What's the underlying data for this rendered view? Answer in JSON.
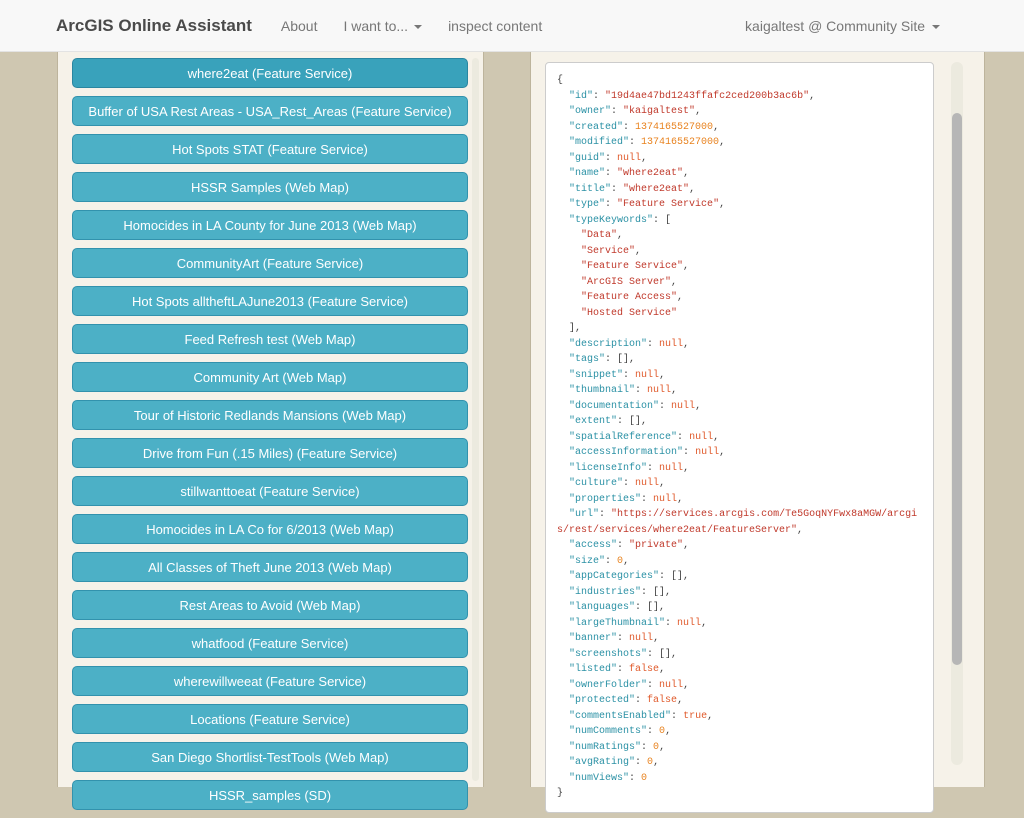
{
  "navbar": {
    "brand": "ArcGIS Online Assistant",
    "links": [
      {
        "label": "About"
      },
      {
        "label": "I want to..."
      },
      {
        "label": "inspect content"
      }
    ],
    "user_menu": {
      "label": "kaigaltest @ Community Site"
    }
  },
  "item_list": {
    "items": [
      {
        "label": "where2eat (Feature Service)",
        "selected": true
      },
      {
        "label": "Buffer of USA Rest Areas - USA_Rest_Areas (Feature Service)",
        "selected": false
      },
      {
        "label": "Hot Spots STAT (Feature Service)",
        "selected": false
      },
      {
        "label": "HSSR Samples (Web Map)",
        "selected": false
      },
      {
        "label": "Homocides in LA County for June 2013 (Web Map)",
        "selected": false
      },
      {
        "label": "CommunityArt (Feature Service)",
        "selected": false
      },
      {
        "label": "Hot Spots alltheftLAJune2013 (Feature Service)",
        "selected": false
      },
      {
        "label": "Feed Refresh test (Web Map)",
        "selected": false
      },
      {
        "label": "Community Art (Web Map)",
        "selected": false
      },
      {
        "label": "Tour of Historic Redlands Mansions (Web Map)",
        "selected": false
      },
      {
        "label": "Drive from Fun (.15 Miles) (Feature Service)",
        "selected": false
      },
      {
        "label": "stillwanttoeat (Feature Service)",
        "selected": false
      },
      {
        "label": "Homocides in LA Co for 6/2013 (Web Map)",
        "selected": false
      },
      {
        "label": "All Classes of Theft June 2013 (Web Map)",
        "selected": false
      },
      {
        "label": "Rest Areas to Avoid (Web Map)",
        "selected": false
      },
      {
        "label": "whatfood (Feature Service)",
        "selected": false
      },
      {
        "label": "wherewillweeat (Feature Service)",
        "selected": false
      },
      {
        "label": "Locations (Feature Service)",
        "selected": false
      },
      {
        "label": "San Diego Shortlist-TestTools (Web Map)",
        "selected": false
      },
      {
        "label": "HSSR_samples (SD)",
        "selected": false,
        "partially_visible": true
      }
    ]
  },
  "json_viewer": {
    "object": {
      "id": "19d4ae47bd1243ffafc2ced200b3ac6b",
      "owner": "kaigaltest",
      "created": 1374165527000,
      "modified": 1374165527000,
      "guid": null,
      "name": "where2eat",
      "title": "where2eat",
      "type": "Feature Service",
      "typeKeywords": [
        "Data",
        "Service",
        "Feature Service",
        "ArcGIS Server",
        "Feature Access",
        "Hosted Service"
      ],
      "description": null,
      "tags": [],
      "snippet": null,
      "thumbnail": null,
      "documentation": null,
      "extent": [],
      "spatialReference": null,
      "accessInformation": null,
      "licenseInfo": null,
      "culture": null,
      "properties": null,
      "url": "https://services.arcgis.com/Te5GoqNYFwx8aMGW/arcgis/rest/services/where2eat/FeatureServer",
      "access": "private",
      "size": 0,
      "appCategories": [],
      "industries": [],
      "languages": [],
      "largeThumbnail": null,
      "banner": null,
      "screenshots": [],
      "listed": false,
      "ownerFolder": null,
      "protected": false,
      "commentsEnabled": true,
      "numComments": 0,
      "numRatings": 0,
      "avgRating": 0,
      "numViews": 0
    }
  },
  "colors": {
    "tan": "#cfc7b1",
    "strip": "#f6f2e9",
    "strip-border": "#bdb49c",
    "navbar-bg": "#f8f8f8",
    "navbar-border": "#e3e3e3",
    "brand": "#4a4a4a",
    "link": "#777777",
    "btn": "#4cb0c6",
    "btn-border": "#3292ad",
    "btn-selected": "#39a2bb",
    "btn-selected-border": "#2a86a0",
    "panel-border": "#cccccc",
    "scroll-track": "#eceadf",
    "scroll-thumb": "#b6b6b6",
    "j-key": "#2b91a5",
    "j-str": "#c0392b",
    "j-num": "#e8821e",
    "j-lit": "#e05a2b"
  }
}
